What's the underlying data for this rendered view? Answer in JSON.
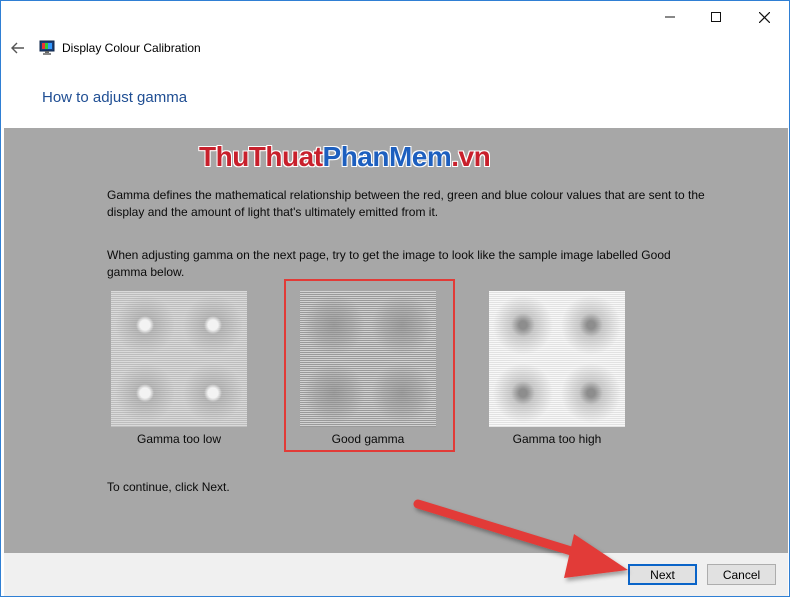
{
  "window": {
    "app_title": "Display Colour Calibration",
    "heading": "How to adjust gamma"
  },
  "watermark": {
    "part1": "ThuThuat",
    "part2": "PhanMem",
    "part3": ".vn"
  },
  "content": {
    "para1": "Gamma defines the mathematical relationship between the red, green and blue colour values that are sent to the display and the amount of light that's ultimately emitted from it.",
    "para2": "When adjusting gamma on the next page, try to get the image to look like the sample image labelled Good gamma below.",
    "para3": "To continue, click Next.",
    "samples": [
      {
        "label": "Gamma too low"
      },
      {
        "label": "Good gamma"
      },
      {
        "label": "Gamma too high"
      }
    ]
  },
  "footer": {
    "next_label": "Next",
    "cancel_label": "Cancel"
  },
  "icons": {
    "minimize": "minimize-icon",
    "maximize": "maximize-icon",
    "close": "close-icon",
    "back": "back-arrow-icon",
    "app": "display-calibration-icon"
  },
  "colors": {
    "heading": "#1f4e93",
    "highlight": "#e23b37",
    "arrow": "#e23b37",
    "content_bg": "#a7a7a7"
  }
}
